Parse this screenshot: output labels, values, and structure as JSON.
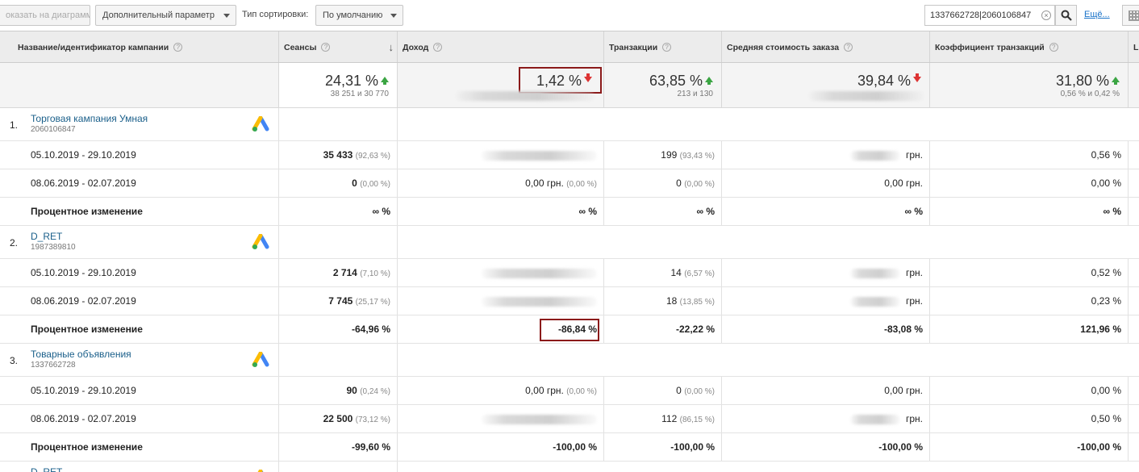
{
  "toolbar": {
    "show_on_chart": "оказать на диаграмме",
    "secondary_dimension": "Дополнительный параметр",
    "sort_type_label": "Тип сортировки:",
    "sort_type_value": "По умолчанию",
    "search_value": "1337662728|2060106847",
    "more_link": "Ещё..."
  },
  "columns": {
    "campaign": "Название/идентификатор кампании",
    "sessions": "Сеансы",
    "revenue": "Доход",
    "transactions": "Транзакции",
    "avg_order_value": "Средняя стоимость заказа",
    "conversion_rate": "Коэффициент транзакций",
    "next_col": "L"
  },
  "summary": {
    "sessions_pct": "24,31 %",
    "sessions_sub": "38 251 и 30 770",
    "revenue_pct": "1,42 %",
    "transactions_pct": "63,85 %",
    "transactions_sub": "213 и 130",
    "aov_pct": "39,84 %",
    "conv_pct": "31,80 %",
    "conv_sub": "0,56 % и 0,42 %"
  },
  "campaigns": [
    {
      "index": "1.",
      "name": "Торговая кампания Умная",
      "id": "2060106847",
      "rows": [
        {
          "label": "05.10.2019 - 29.10.2019",
          "sessions": "35 433",
          "sessions_pp": "(92,63 %)",
          "revenue": "",
          "revenue_pp": "",
          "transactions": "199",
          "transactions_pp": "(93,43 %)",
          "aov": "грн.",
          "conv": "0,56 %"
        },
        {
          "label": "08.06.2019 - 02.07.2019",
          "sessions": "0",
          "sessions_pp": "(0,00 %)",
          "revenue": "0,00 грн.",
          "revenue_pp": "(0,00 %)",
          "transactions": "0",
          "transactions_pp": "(0,00 %)",
          "aov": "0,00 грн.",
          "conv": "0,00 %"
        },
        {
          "label": "Процентное изменение",
          "sessions": "∞ %",
          "sessions_pp": "",
          "revenue": "∞ %",
          "revenue_pp": "",
          "transactions": "∞ %",
          "transactions_pp": "",
          "aov": "∞ %",
          "conv": "∞ %"
        }
      ]
    },
    {
      "index": "2.",
      "name": "D_RET",
      "id": "1987389810",
      "rows": [
        {
          "label": "05.10.2019 - 29.10.2019",
          "sessions": "2 714",
          "sessions_pp": "(7,10 %)",
          "revenue": "",
          "revenue_pp": "",
          "transactions": "14",
          "transactions_pp": "(6,57 %)",
          "aov": "грн.",
          "conv": "0,52 %"
        },
        {
          "label": "08.06.2019 - 02.07.2019",
          "sessions": "7 745",
          "sessions_pp": "(25,17 %)",
          "revenue": "",
          "revenue_pp": "",
          "transactions": "18",
          "transactions_pp": "(13,85 %)",
          "aov": "грн.",
          "conv": "0,23 %"
        },
        {
          "label": "Процентное изменение",
          "sessions": "-64,96 %",
          "sessions_pp": "",
          "revenue": "-86,84 %",
          "revenue_pp": "",
          "transactions": "-22,22 %",
          "transactions_pp": "",
          "aov": "-83,08 %",
          "conv": "121,96 %"
        }
      ]
    },
    {
      "index": "3.",
      "name": "Товарные объявления",
      "id": "1337662728",
      "rows": [
        {
          "label": "05.10.2019 - 29.10.2019",
          "sessions": "90",
          "sessions_pp": "(0,24 %)",
          "revenue": "0,00 грн.",
          "revenue_pp": "(0,00 %)",
          "transactions": "0",
          "transactions_pp": "(0,00 %)",
          "aov": "0,00 грн.",
          "conv": "0,00 %"
        },
        {
          "label": "08.06.2019 - 02.07.2019",
          "sessions": "22 500",
          "sessions_pp": "(73,12 %)",
          "revenue": "",
          "revenue_pp": "",
          "transactions": "112",
          "transactions_pp": "(86,15 %)",
          "aov": "грн.",
          "conv": "0,50 %"
        },
        {
          "label": "Процентное изменение",
          "sessions": "-99,60 %",
          "sessions_pp": "",
          "revenue": "-100,00 %",
          "revenue_pp": "",
          "transactions": "-100,00 %",
          "transactions_pp": "",
          "aov": "-100,00 %",
          "conv": "-100,00 %"
        }
      ]
    }
  ],
  "partial_next_campaign": "D_RET",
  "colors": {
    "positive": "#3ba543",
    "negative": "#dd3333",
    "highlight_border": "#8b1a1a",
    "link": "#1a5f8a"
  }
}
